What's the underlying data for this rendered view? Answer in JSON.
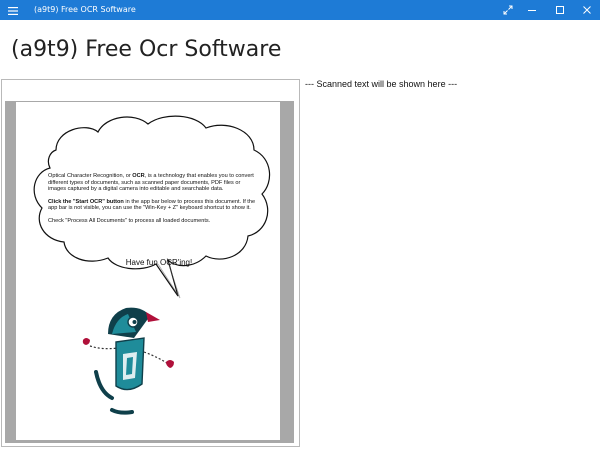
{
  "window": {
    "title": "(a9t9) Free OCR Software",
    "menu_icon": "hamburger-icon",
    "controls": [
      "expand-icon",
      "minimize-icon",
      "maximize-icon",
      "close-icon"
    ]
  },
  "page": {
    "title": "(a9t9) Free Ocr Software"
  },
  "document": {
    "para1_prefix": "Optical Character Recognition, or ",
    "para1_bold": "OCR",
    "para1_suffix": ", is a technology that enables you to convert different types of documents, such as scanned paper documents, PDF files or images captured by a digital camera into editable and searchable data.",
    "para2_bold": "Click the \"Start OCR\" button",
    "para2_suffix": " in the app bar below to process this document. If the app bar is not visible, you can use the \"Win-Key + Z\" keyboard shortcut to show it.",
    "para3": "Check \"Process All Documents\" to process all loaded documents.",
    "tagline": "Have fun OCR'ing!"
  },
  "output": {
    "placeholder": "--- Scanned text will be shown here ---"
  },
  "colors": {
    "titlebar": "#1e7bd6",
    "robot_teal": "#1f8c9a",
    "robot_dark": "#0f3f4a",
    "accent_red": "#b0103a"
  }
}
